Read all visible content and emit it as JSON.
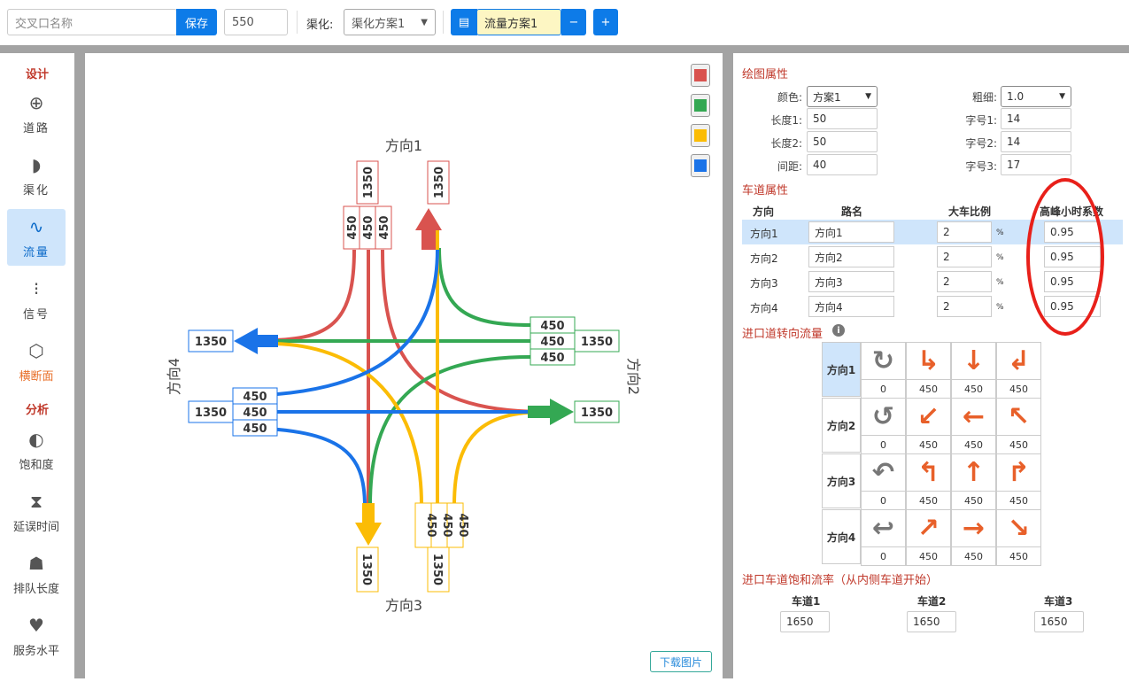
{
  "topbar": {
    "name_placeholder": "交叉口名称",
    "save_label": "保存",
    "size_value": "550",
    "channel_label": "渠化:",
    "channel_select": "渠化方案1",
    "flow_scheme": "流量方案1",
    "minus_label": "−",
    "plus_label": "+"
  },
  "sidebar": {
    "design_heading": "设计",
    "analysis_heading": "分析",
    "items": [
      {
        "label": "道路",
        "icon": "crosshair-icon"
      },
      {
        "label": "渠化",
        "icon": "channel-icon"
      },
      {
        "label": "流量",
        "icon": "pulse-icon"
      },
      {
        "label": "信号",
        "icon": "traffic-light-icon"
      },
      {
        "label": "横断面",
        "icon": "hexagon-icon"
      },
      {
        "label": "饱和度",
        "icon": "half-circle-icon"
      },
      {
        "label": "延误时间",
        "icon": "hourglass-icon"
      },
      {
        "label": "排队长度",
        "icon": "people-icon"
      },
      {
        "label": "服务水平",
        "icon": "heart-hands-icon"
      }
    ]
  },
  "canvas": {
    "dir1": "方向1",
    "dir2": "方向2",
    "dir3": "方向3",
    "dir4": "方向4",
    "total": "1350",
    "lane": "450",
    "download": "下载图片",
    "colors": {
      "red": "#d9534f",
      "green": "#34a853",
      "yellow": "#fbbc05",
      "blue": "#1a73e8"
    }
  },
  "drawing": {
    "title": "绘图属性",
    "color_label": "颜色:",
    "color_value": "方案1",
    "width_label": "粗细:",
    "width_value": "1.0",
    "len1_label": "长度1:",
    "len1_value": "50",
    "len2_label": "长度2:",
    "len2_value": "50",
    "gap_label": "间距:",
    "gap_value": "40",
    "font1_label": "字号1:",
    "font1_value": "14",
    "font2_label": "字号2:",
    "font2_value": "14",
    "font3_label": "字号3:",
    "font3_value": "17"
  },
  "lane_props": {
    "title": "车道属性",
    "headers": [
      "方向",
      "路名",
      "大车比例",
      "高峰小时系数"
    ],
    "rows": [
      {
        "dir": "方向1",
        "road": "方向1",
        "ratio": "2",
        "unit": "%",
        "phf": "0.95"
      },
      {
        "dir": "方向2",
        "road": "方向2",
        "ratio": "2",
        "unit": "%",
        "phf": "0.95"
      },
      {
        "dir": "方向3",
        "road": "方向3",
        "ratio": "2",
        "unit": "%",
        "phf": "0.95"
      },
      {
        "dir": "方向4",
        "road": "方向4",
        "ratio": "2",
        "unit": "%",
        "phf": "0.95"
      }
    ]
  },
  "turn_flow": {
    "title": "进口道转向流量",
    "rows": [
      {
        "dir": "方向1",
        "values": [
          "0",
          "450",
          "450",
          "450"
        ]
      },
      {
        "dir": "方向2",
        "values": [
          "0",
          "450",
          "450",
          "450"
        ]
      },
      {
        "dir": "方向3",
        "values": [
          "0",
          "450",
          "450",
          "450"
        ]
      },
      {
        "dir": "方向4",
        "values": [
          "0",
          "450",
          "450",
          "450"
        ]
      }
    ]
  },
  "saturation": {
    "title": "进口车道饱和流率（从内侧车道开始）",
    "lanes": [
      {
        "label": "车道1",
        "value": "1650"
      },
      {
        "label": "车道2",
        "value": "1650"
      },
      {
        "label": "车道3",
        "value": "1650"
      }
    ]
  }
}
